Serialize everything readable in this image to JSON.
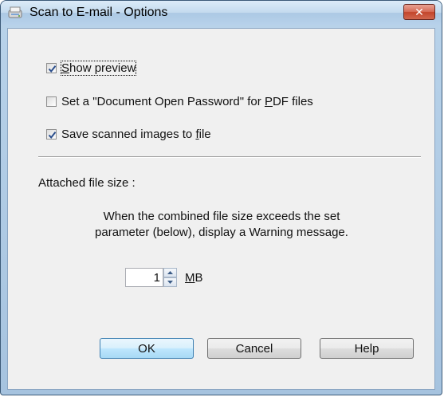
{
  "window": {
    "title": "Scan to E-mail - Options",
    "close_glyph": "✕"
  },
  "options": [
    {
      "pre": "",
      "key": "S",
      "post": "how preview",
      "checked": true
    },
    {
      "pre": "Set a \"Document Open Password\" for ",
      "key": "P",
      "post": "DF files",
      "checked": false
    },
    {
      "pre": "Save scanned images to ",
      "key": "f",
      "post": "ile",
      "checked": true
    }
  ],
  "attached": {
    "label": "Attached file size :",
    "description_line1": "When the combined file size exceeds the set",
    "description_line2": "parameter (below), display a Warning message.",
    "value": "1",
    "unit_key": "M",
    "unit_rest": "B"
  },
  "buttons": {
    "ok": "OK",
    "cancel": "Cancel",
    "help": "Help"
  },
  "colors": {
    "accent": "#3c7fb1",
    "check": "#2a4e8c",
    "close": "#c3452b"
  }
}
